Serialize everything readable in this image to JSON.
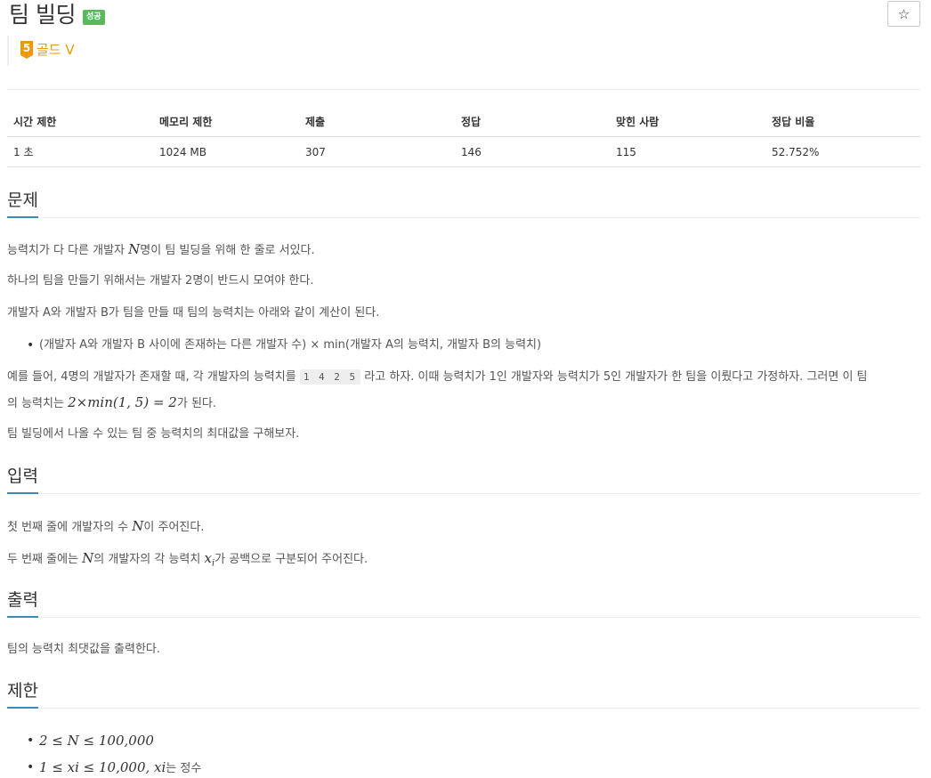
{
  "problem": {
    "title": "팀 빌딩",
    "status_badge": "성공",
    "star_icon": "☆",
    "tier_level": "5",
    "tier_name": "골드 V"
  },
  "info_table": {
    "headers": [
      "시간 제한",
      "메모리 제한",
      "제출",
      "정답",
      "맞힌 사람",
      "정답 비율"
    ],
    "values": [
      "1 초",
      "1024 MB",
      "307",
      "146",
      "115",
      "52.752%"
    ]
  },
  "sections": {
    "problem_heading": "문제",
    "input_heading": "입력",
    "output_heading": "출력",
    "limit_heading": "제한"
  },
  "problem_text": {
    "p1_a": "능력치가 다 다른 개발자 ",
    "p1_var": "N",
    "p1_b": "명이 팀 빌딩을 위해 한 줄로 서있다.",
    "p2": "하나의 팀을 만들기 위해서는 개발자 2명이 반드시 모여야 한다.",
    "p3": "개발자 A와 개발자 B가 팀을 만들 때 팀의 능력치는 아래와 같이 계산이 된다.",
    "bullet1": "(개발자 A와 개발자 B 사이에 존재하는 다른 개발자 수) × min(개발자 A의 능력치, 개발자 B의 능력치)",
    "p4_a": "예를 들어, 4명의 개발자가 존재할 때, 각 개발자의 능력치를 ",
    "p4_code": "1 4 2 5",
    "p4_b": " 라고 하자. 이때 능력치가 1인 개발자와 능력치가 5인 개발자가 한 팀을 이뤘다고 가정하자. 그러면 이 팀",
    "p4_c": "의 능력치는 ",
    "p4_math": "2×min(1, 5) = 2",
    "p4_d": "가 된다.",
    "p5": "팀 빌딩에서 나올 수 있는 팀 중 능력치의 최대값을 구해보자."
  },
  "input_text": {
    "l1_a": "첫 번째 줄에 개발자의 수 ",
    "l1_var": "N",
    "l1_b": "이 주어진다.",
    "l2_a": "두 번째 줄에는 ",
    "l2_var": "N",
    "l2_b": "의 개발자의 각 능력치 ",
    "l2_var2": "x",
    "l2_sub": "i",
    "l2_c": "가 공백으로 구분되어 주어진다."
  },
  "output_text": {
    "l1": "팀의 능력치 최댓값을 출력한다."
  },
  "limit_text": {
    "b1": "2 ≤ N ≤ 100,000",
    "b2_math": "1 ≤ xi ≤ 10,000, xi",
    "b2_tail": "는 정수"
  }
}
